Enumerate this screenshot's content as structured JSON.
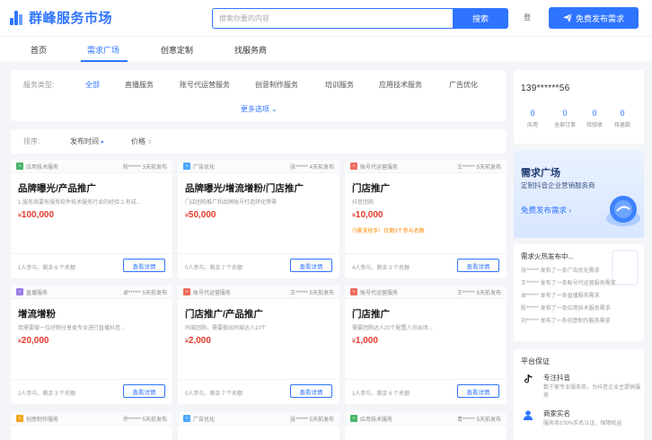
{
  "header": {
    "brand": "群峰服务市场",
    "search_placeholder": "搜索你要的内容",
    "search_button": "搜索",
    "login": "登",
    "publish_button": "免费发布需求"
  },
  "nav": {
    "items": [
      "首页",
      "需求广场",
      "创意定制",
      "找服务商"
    ],
    "active_index": 1
  },
  "filter": {
    "label": "服务类型:",
    "options": [
      "全部",
      "直播服务",
      "账号代运营服务",
      "创意制作服务",
      "培训服务",
      "应用技术服务",
      "广告优化"
    ],
    "more": "更多选项"
  },
  "sort": {
    "label": "排序:",
    "options": [
      "发布时间",
      "价格"
    ]
  },
  "colors": {
    "accent": "#2f74ff",
    "price": "#e5392b",
    "warning": "#ff8a00"
  },
  "cards": [
    {
      "category": "应用技术服务",
      "cat_color": "#4bb56b",
      "user": "陈******",
      "time": "3天前发布",
      "title": "品牌曝光/产品推广",
      "desc": "1.服务商要有服务软件技术服务行业的经验 2.有成...",
      "price": "100,000",
      "note": "",
      "stats": "1人参与，剩余 6 个名额",
      "button": "查看详情"
    },
    {
      "category": "广告优化",
      "cat_color": "#4aa8ff",
      "user": "张******",
      "time": "4天前发布",
      "title": "品牌曝光/增流增粉/门店推广",
      "desc": "门店团购推广和品牌账号打造转化等需",
      "price": "50,000",
      "note": "",
      "stats": "0人参与，剩余 7 个名额",
      "button": "查看详情"
    },
    {
      "category": "账号代运营服务",
      "cat_color": "#f06c5e",
      "user": "王******",
      "time": "5天前发布",
      "title": "门店推广",
      "desc": "抖音团购",
      "price": "10,000",
      "note": "需求抢手！仅剩3个参与名额",
      "stats": "4人参与，剩余 3 个名额",
      "button": "查看详情"
    },
    {
      "category": "直播服务",
      "cat_color": "#9b7bea",
      "user": "卓******",
      "time": "5天前发布",
      "title": "增流增粉",
      "desc": "我需要做一位好物分享类专业进行直播抖音...",
      "price": "20,000",
      "note": "",
      "stats": "2人参与，剩余 3 个名额",
      "button": "查看详情"
    },
    {
      "category": "账号代运营服务",
      "cat_color": "#f06c5e",
      "user": "王******",
      "time": "5天前发布",
      "title": "门店推广/产品推广",
      "desc": "同城团购，需要做出同城达人10个",
      "price": "2,000",
      "note": "",
      "stats": "0人参与，剩余 7 个名额",
      "button": "查看详情"
    },
    {
      "category": "账号代运营服务",
      "cat_color": "#f06c5e",
      "user": "王******",
      "time": "5天前发布",
      "title": "门店推广",
      "desc": "需要团购达人20个配置人员出场...",
      "price": "1,000",
      "note": "",
      "stats": "1人参与，剩余 6 个名额",
      "button": "查看详情"
    },
    {
      "category": "创意制作服务",
      "cat_color": "#f5a623",
      "user": "乔******",
      "time": "5天前发布",
      "title": "",
      "desc": "",
      "price": "",
      "note": "",
      "stats": "",
      "button": ""
    },
    {
      "category": "广告优化",
      "cat_color": "#4aa8ff",
      "user": "张******",
      "time": "5天前发布",
      "title": "",
      "desc": "",
      "price": "",
      "note": "",
      "stats": "",
      "button": ""
    },
    {
      "category": "应用技术服务",
      "cat_color": "#4bb56b",
      "user": "青******",
      "time": "5天前发布",
      "title": "",
      "desc": "",
      "price": "",
      "note": "",
      "stats": "",
      "button": ""
    }
  ],
  "user_panel": {
    "user_id": "139******56",
    "stats": [
      {
        "value": "0",
        "label": "应用"
      },
      {
        "value": "0",
        "label": "全部订单"
      },
      {
        "value": "0",
        "label": "待验收"
      },
      {
        "value": "0",
        "label": "待退款"
      }
    ]
  },
  "promo": {
    "title": "需求广场",
    "subtitle": "定制抖音企业营销服务商",
    "link": "免费发布需求"
  },
  "news": {
    "title": "需求火热发布中...",
    "items": [
      "张****** 发布了一条广告优化需求",
      "王****** 发布了一条账号代运营服务需求",
      "卓****** 发布了一条直播服务需求",
      "陈****** 发布了一条应用技术服务需求",
      "刘****** 发布了一条创意制作服务需求"
    ]
  },
  "guarantee": {
    "title": "平台保证",
    "items": [
      {
        "name": "专注抖音",
        "desc": "数千家专业服务商，为抖音企业主提供服务"
      },
      {
        "name": "商家实名",
        "desc": "服务商100%实名认证，保障权益"
      }
    ]
  }
}
